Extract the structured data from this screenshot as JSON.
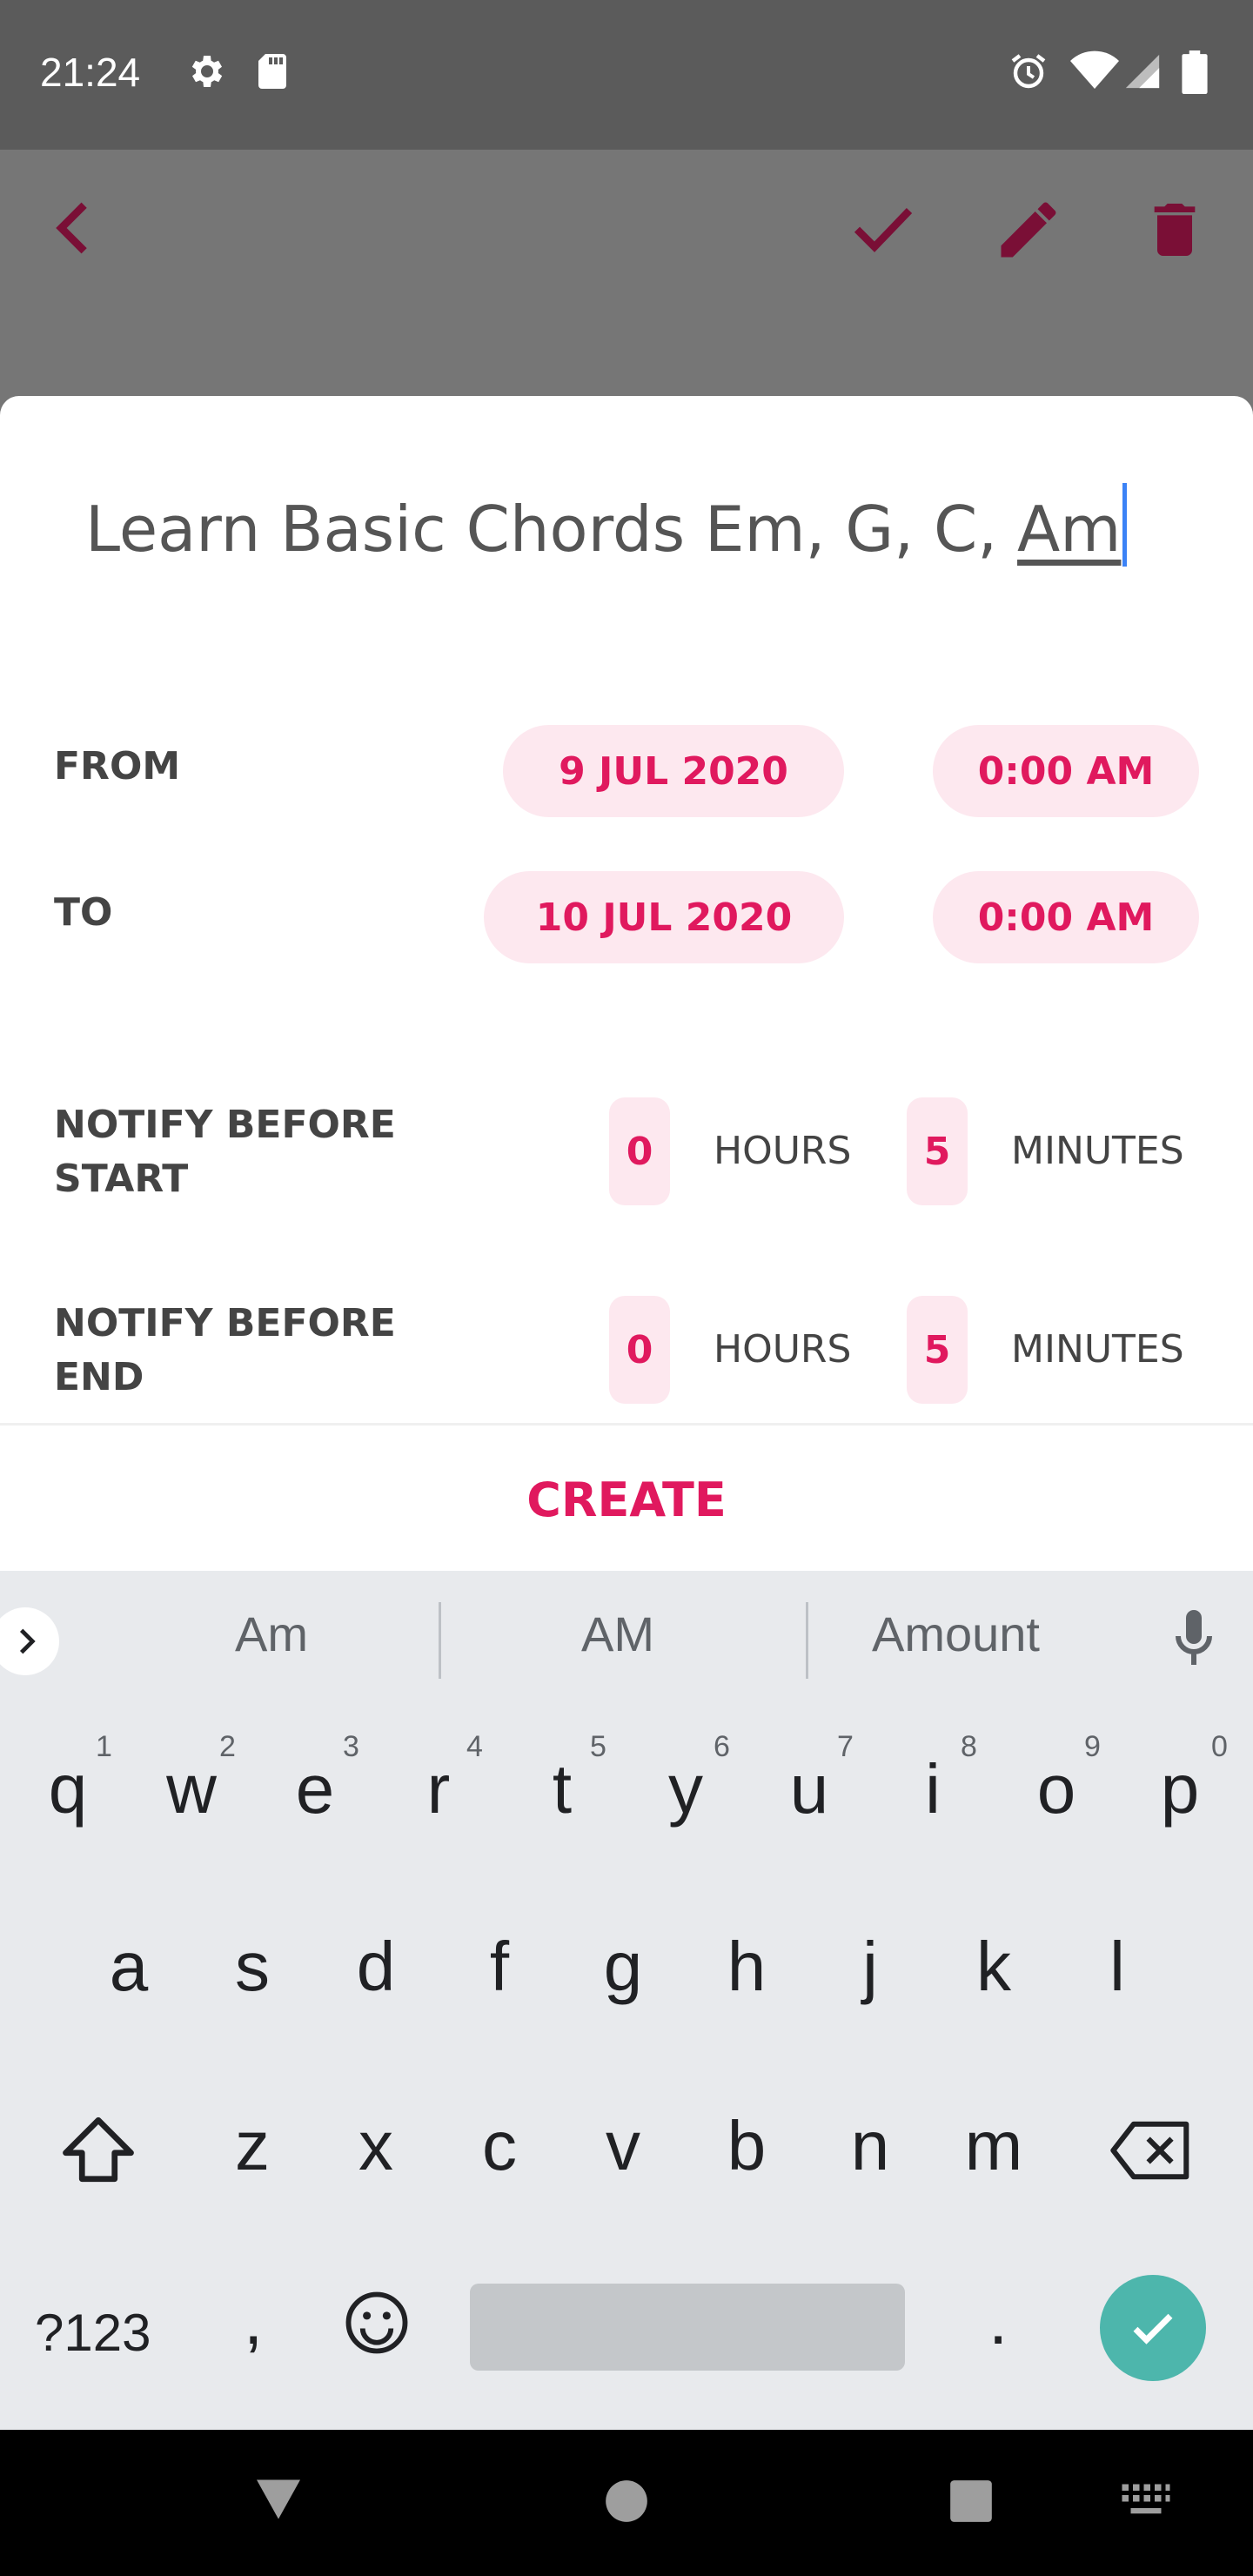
{
  "status_bar": {
    "time": "21:24"
  },
  "event": {
    "title_prefix": "Learn Basic Chords Em, G, C, ",
    "title_current_word": "Am"
  },
  "form": {
    "from_label": "FROM",
    "from_date": "9 JUL 2020",
    "from_time": "0:00 AM",
    "to_label": "TO",
    "to_date": "10 JUL 2020",
    "to_time": "0:00 AM",
    "notify_start_label_1": "NOTIFY BEFORE",
    "notify_start_label_2": "START",
    "notify_start_hours": "0",
    "notify_start_minutes": "5",
    "notify_end_label_1": "NOTIFY BEFORE",
    "notify_end_label_2": "END",
    "notify_end_hours": "0",
    "notify_end_minutes": "5",
    "hours_unit": "HOURS",
    "minutes_unit": "MINUTES",
    "create_label": "CREATE"
  },
  "keyboard": {
    "suggestions": [
      "Am",
      "AM",
      "Amount"
    ],
    "row1": [
      "q",
      "w",
      "e",
      "r",
      "t",
      "y",
      "u",
      "i",
      "o",
      "p"
    ],
    "row1_hints": [
      "1",
      "2",
      "3",
      "4",
      "5",
      "6",
      "7",
      "8",
      "9",
      "0"
    ],
    "row2": [
      "a",
      "s",
      "d",
      "f",
      "g",
      "h",
      "j",
      "k",
      "l"
    ],
    "row3": [
      "z",
      "x",
      "c",
      "v",
      "b",
      "n",
      "m"
    ],
    "symbols_label": "?123",
    "comma": ",",
    "period": "."
  },
  "colors": {
    "accent": "#e0195e",
    "chip_bg": "#fde8ef",
    "appbar_icon": "#7a0f36",
    "enter_key": "#4db6ac"
  },
  "icons": [
    "settings-icon",
    "sd-card-icon",
    "alarm-icon",
    "wifi-icon",
    "signal-icon",
    "battery-icon",
    "back-icon",
    "check-icon",
    "edit-icon",
    "delete-icon",
    "expand-suggestions-icon",
    "mic-icon",
    "shift-icon",
    "backspace-icon",
    "emoji-icon",
    "enter-check-icon",
    "nav-back-icon",
    "nav-home-icon",
    "nav-recents-icon",
    "keyboard-switch-icon"
  ]
}
